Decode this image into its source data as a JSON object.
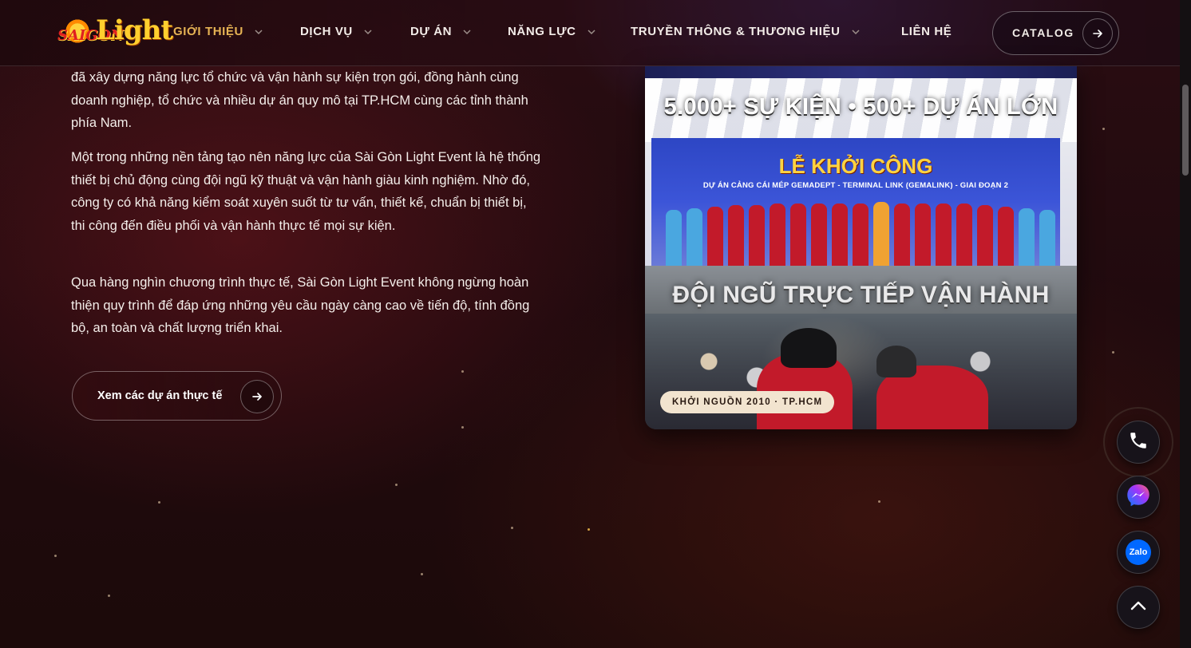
{
  "header": {
    "logo": {
      "alt": "Saigon Light",
      "word_left": "SAIGON",
      "word_right": "Light"
    },
    "nav": [
      {
        "label": "GIỚI THIỆU",
        "active": true,
        "has_dropdown": true
      },
      {
        "label": "DỊCH VỤ",
        "active": false,
        "has_dropdown": true
      },
      {
        "label": "DỰ ÁN",
        "active": false,
        "has_dropdown": true
      },
      {
        "label": "NĂNG LỰC",
        "active": false,
        "has_dropdown": true
      },
      {
        "label": "TRUYỀN THÔNG & THƯƠNG HIỆU",
        "active": false,
        "has_dropdown": true
      },
      {
        "label": "LIÊN HỆ",
        "active": false,
        "has_dropdown": false
      }
    ],
    "catalog_label": "CATALOG"
  },
  "content": {
    "paragraphs": [
      "đã xây dựng năng lực tổ chức và vận hành sự kiện trọn gói, đồng hành cùng doanh nghiệp, tổ chức và nhiều dự án quy mô tại TP.HCM cùng các tỉnh thành phía Nam.",
      "Một trong những nền tảng tạo nên năng lực của Sài Gòn Light Event là hệ thống thiết bị chủ động cùng đội ngũ kỹ thuật và vận hành giàu kinh nghiệm. Nhờ đó, công ty có khả năng kiểm soát xuyên suốt từ tư vấn, thiết kế, chuẩn bị thiết bị, thi công đến điều phối và vận hành thực tế mọi sự kiện.",
      "Qua hàng nghìn chương trình thực tế, Sài Gòn Light Event không ngừng hoàn thiện quy trình để đáp ứng những yêu cầu ngày càng cao về tiến độ, tính đồng bộ, an toàn và chất lượng triển khai."
    ],
    "cta_label": "Xem các dự án thực tế"
  },
  "card": {
    "headline_top": "5.000+ SỰ KIỆN • 500+ DỰ ÁN LỚN",
    "banner_title": "LỄ KHỞI CÔNG",
    "banner_subtitle": "DỰ ÁN CẢNG CÁI MÉP GEMADEPT - TERMINAL LINK (GEMALINK) - GIAI ĐOẠN 2",
    "headline_bottom": "ĐỘI NGŨ TRỰC TIẾP VẬN HÀNH",
    "badge": "KHỞI NGUỒN 2010 · TP.HCM"
  },
  "floating": {
    "buttons": [
      "phone-icon",
      "messenger-icon",
      "zalo-icon",
      "chevron-up-icon"
    ],
    "zalo_label": "Zalo"
  },
  "colors": {
    "accent_gold": "#e6b354",
    "banner_blue": "#2d46c4",
    "banner_title": "#ffd340",
    "uniform_red": "#c21a2a",
    "messenger_a": "#0a7cff",
    "messenger_b": "#a334fa",
    "zalo": "#0068ff"
  }
}
